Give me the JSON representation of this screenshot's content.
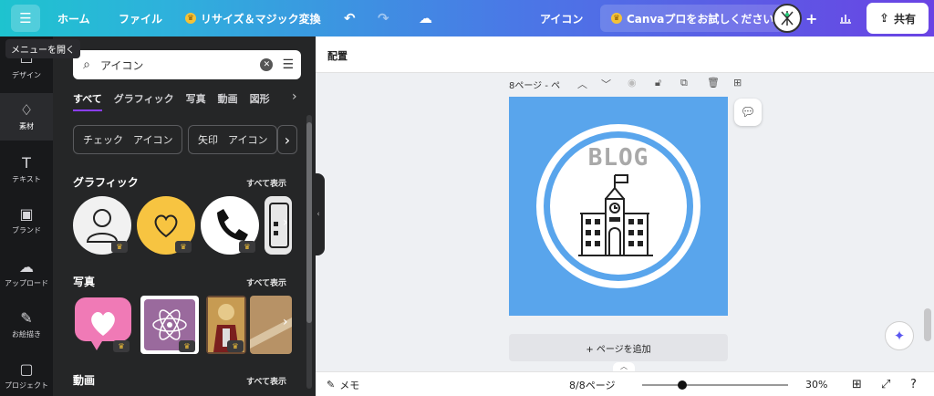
{
  "topbar": {
    "home": "ホーム",
    "file": "ファイル",
    "resize": "リサイズ＆マジック変換",
    "doc_title": "アイコン",
    "pro": "Canvaプロをお試しください",
    "share": "共有",
    "tooltip": "メニューを開く"
  },
  "rail": [
    {
      "label": "デザイン",
      "icon": "design-icon"
    },
    {
      "label": "素材",
      "icon": "elements-icon"
    },
    {
      "label": "テキスト",
      "icon": "text-icon"
    },
    {
      "label": "ブランド",
      "icon": "brand-icon"
    },
    {
      "label": "アップロード",
      "icon": "upload-icon"
    },
    {
      "label": "お絵描き",
      "icon": "draw-icon"
    },
    {
      "label": "プロジェクト",
      "icon": "folder-icon"
    }
  ],
  "panel": {
    "search_value": "アイコン",
    "tabs": [
      "すべて",
      "グラフィック",
      "写真",
      "動画",
      "図形"
    ],
    "chips": [
      "チェック　アイコン",
      "矢印　アイコン"
    ],
    "graphics_title": "グラフィック",
    "photos_title": "写真",
    "videos_title": "動画",
    "see_all": "すべて表示"
  },
  "editor": {
    "position_label": "配置",
    "page_label": "8ページ - ペ",
    "canvas_text": "BLOG",
    "add_page": "+ ページを追加"
  },
  "footer": {
    "notes": "メモ",
    "page_count": "8/8ページ",
    "zoom": "30%",
    "zoom_fraction": 0.3
  },
  "colors": {
    "canvas_bg": "#59a5ec",
    "accent": "#8b3dff",
    "crown": "#f4c237"
  }
}
